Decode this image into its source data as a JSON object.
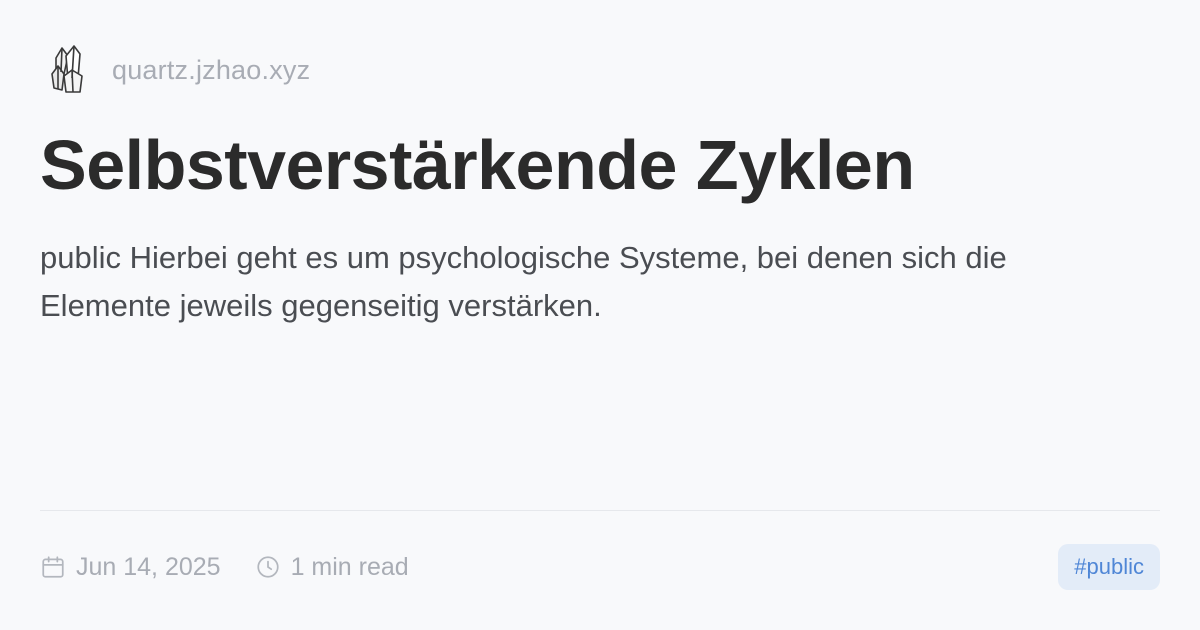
{
  "site": {
    "logo_icon": "crystal-icon",
    "name": "quartz.jzhao.xyz"
  },
  "title": "Selbstverstärkende Zyklen",
  "description": "public Hierbei geht es um psychologische Systeme, bei denen sich die Elemente jeweils gegenseitig verstärken.",
  "meta": {
    "date_icon": "calendar-icon",
    "date": "Jun 14, 2025",
    "reading_icon": "clock-icon",
    "reading_time": "1 min read"
  },
  "tags": [
    "#public"
  ],
  "colors": {
    "background": "#f8f9fb",
    "title": "#2b2b2b",
    "muted": "#a8acb4",
    "tag_bg": "#e3ecf8",
    "tag_text": "#4f86d6"
  }
}
